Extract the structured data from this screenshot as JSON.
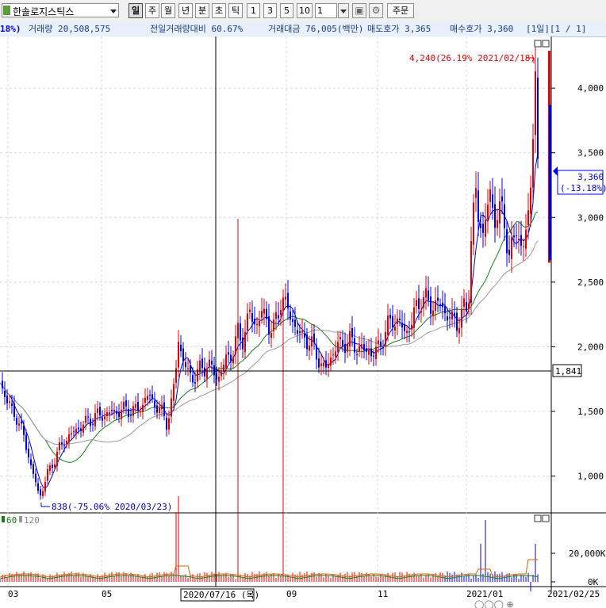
{
  "toolbar": {
    "stock_name": "한솔로지스틱스",
    "periods": [
      "일",
      "주",
      "월",
      "년",
      "분",
      "초",
      "틱"
    ],
    "active_period": "일",
    "quick_numbers": [
      "1",
      "3",
      "5",
      "10"
    ],
    "num_input": "1",
    "order_label": "주문"
  },
  "infobar": {
    "change_pct": "18%)",
    "volume": "거래량 20,508,575",
    "prev_vol_ratio": "전일거래량대비 60.67%",
    "trade_value": "거래대금 76,005(백만)",
    "ask": "매도호가 3,365",
    "bid": "매수호가 3,360",
    "page": "[1일][1 / 1]"
  },
  "chart_data": {
    "type": "candlestick",
    "price_axis": {
      "ticks": [
        "4,000",
        "3,500",
        "3,000",
        "2,500",
        "2,000",
        "1,500",
        "1,000"
      ],
      "ylim": [
        700,
        4400
      ]
    },
    "volume_axis": {
      "ticks": [
        "20,000K",
        "0K"
      ]
    },
    "x_ticks": [
      "03",
      "05",
      "09",
      "11",
      "2021/01",
      "2021/02/25"
    ],
    "crosshair": {
      "date": "2020/07/16 (목)",
      "price": "1,841"
    },
    "current_price": {
      "value": "3,360",
      "change": "(-13.18%)"
    },
    "high_annotation": "4,240(26.19% 2021/02/18)",
    "low_annotation": "838(-75.06% 2020/03/23)",
    "volume_legend": [
      "60",
      "120"
    ],
    "up_color": "#e60000",
    "down_color": "#0000e6",
    "price_path": [
      [
        0,
        1720
      ],
      [
        5,
        1660
      ],
      [
        10,
        1560
      ],
      [
        15,
        1500
      ],
      [
        20,
        1480
      ],
      [
        25,
        1380
      ],
      [
        30,
        1300
      ],
      [
        35,
        1200
      ],
      [
        40,
        1040
      ],
      [
        45,
        950
      ],
      [
        50,
        838
      ],
      [
        55,
        920
      ],
      [
        60,
        1020
      ],
      [
        65,
        1080
      ],
      [
        70,
        1150
      ],
      [
        75,
        1210
      ],
      [
        80,
        1260
      ],
      [
        85,
        1300
      ],
      [
        90,
        1320
      ],
      [
        95,
        1350
      ],
      [
        100,
        1380
      ],
      [
        105,
        1400
      ],
      [
        110,
        1420
      ],
      [
        115,
        1440
      ],
      [
        120,
        1460
      ],
      [
        125,
        1470
      ],
      [
        130,
        1470
      ],
      [
        135,
        1480
      ],
      [
        140,
        1490
      ],
      [
        145,
        1500
      ],
      [
        150,
        1500
      ],
      [
        155,
        1510
      ],
      [
        160,
        1520
      ],
      [
        165,
        1510
      ],
      [
        170,
        1500
      ],
      [
        175,
        1520
      ],
      [
        180,
        1560
      ],
      [
        185,
        1620
      ],
      [
        190,
        1600
      ],
      [
        195,
        1560
      ],
      [
        200,
        1520
      ],
      [
        205,
        1480
      ],
      [
        210,
        1420
      ],
      [
        215,
        1520
      ],
      [
        220,
        1700
      ],
      [
        225,
        2080
      ],
      [
        230,
        1900
      ],
      [
        235,
        1820
      ],
      [
        240,
        1780
      ],
      [
        245,
        1760
      ],
      [
        250,
        1800
      ],
      [
        255,
        1840
      ],
      [
        260,
        1860
      ],
      [
        265,
        1840
      ],
      [
        270,
        1800
      ],
      [
        275,
        1760
      ],
      [
        280,
        1820
      ],
      [
        285,
        1900
      ],
      [
        290,
        1940
      ],
      [
        295,
        1980
      ],
      [
        300,
        2100
      ],
      [
        305,
        2050
      ],
      [
        310,
        2150
      ],
      [
        315,
        2250
      ],
      [
        320,
        2200
      ],
      [
        325,
        2180
      ],
      [
        330,
        2260
      ],
      [
        335,
        2220
      ],
      [
        340,
        2160
      ],
      [
        345,
        2140
      ],
      [
        350,
        2220
      ],
      [
        355,
        2420
      ],
      [
        360,
        2320
      ],
      [
        365,
        2240
      ],
      [
        370,
        2200
      ],
      [
        375,
        2120
      ],
      [
        380,
        2060
      ],
      [
        385,
        2080
      ],
      [
        390,
        2040
      ],
      [
        395,
        1980
      ],
      [
        400,
        1940
      ],
      [
        405,
        1860
      ],
      [
        410,
        1810
      ],
      [
        415,
        1900
      ],
      [
        420,
        1960
      ],
      [
        425,
        2000
      ],
      [
        430,
        2020
      ],
      [
        435,
        2040
      ],
      [
        440,
        2040
      ],
      [
        445,
        2020
      ],
      [
        450,
        2000
      ],
      [
        455,
        1980
      ],
      [
        460,
        1960
      ],
      [
        465,
        1980
      ],
      [
        470,
        1940
      ],
      [
        475,
        1960
      ],
      [
        480,
        2040
      ],
      [
        485,
        2100
      ],
      [
        490,
        2160
      ],
      [
        495,
        2220
      ],
      [
        500,
        2200
      ],
      [
        505,
        2160
      ],
      [
        510,
        2120
      ],
      [
        515,
        2140
      ],
      [
        520,
        2200
      ],
      [
        525,
        2300
      ],
      [
        530,
        2380
      ],
      [
        535,
        2360
      ],
      [
        540,
        2340
      ],
      [
        545,
        2320
      ],
      [
        550,
        2330
      ],
      [
        555,
        2320
      ],
      [
        560,
        2280
      ],
      [
        565,
        2250
      ],
      [
        570,
        2200
      ],
      [
        575,
        2180
      ],
      [
        580,
        2240
      ],
      [
        585,
        2280
      ],
      [
        590,
        2260
      ],
      [
        595,
        3000
      ],
      [
        600,
        3200
      ],
      [
        603,
        2950
      ],
      [
        608,
        2860
      ],
      [
        612,
        3060
      ],
      [
        617,
        3120
      ],
      [
        622,
        3000
      ],
      [
        627,
        3080
      ],
      [
        632,
        3040
      ],
      [
        637,
        2900
      ],
      [
        641,
        2700
      ],
      [
        645,
        2820
      ],
      [
        650,
        2840
      ],
      [
        655,
        2800
      ],
      [
        660,
        2860
      ],
      [
        665,
        2900
      ],
      [
        668,
        3000
      ],
      [
        671,
        3600
      ],
      [
        675,
        4240
      ],
      [
        678,
        3360
      ]
    ]
  }
}
